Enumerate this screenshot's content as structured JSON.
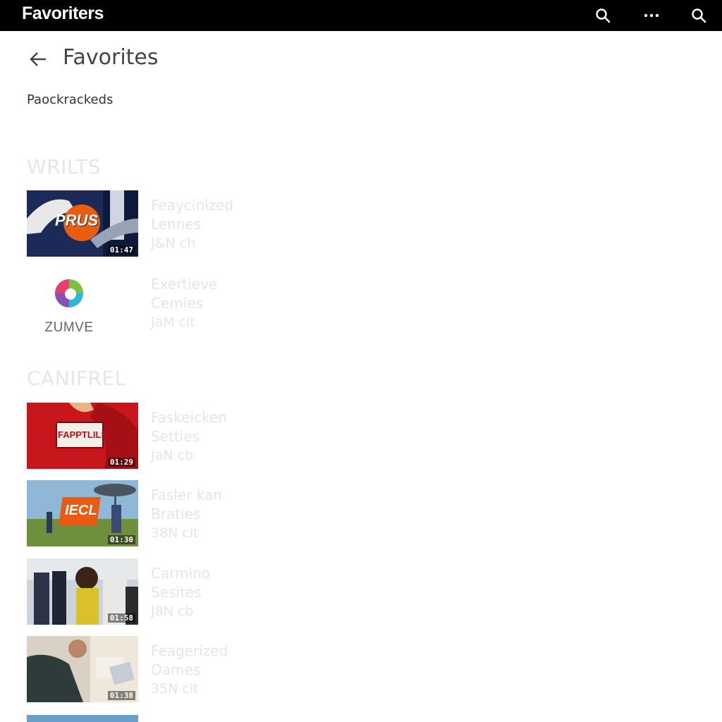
{
  "topbar": {
    "app_title": "Favoriters",
    "icons": [
      "search-icon",
      "more-icon",
      "search-icon"
    ]
  },
  "header": {
    "title": "Favorites",
    "subheader": "Paockrackeds"
  },
  "sections": [
    {
      "title": "WRILTS",
      "items": [
        {
          "thumb": "prus",
          "thumb_text": "PRUS",
          "duration": "01:47",
          "line1": "Feaycinized",
          "line2": "Lennes",
          "line3": "J&N ch"
        },
        {
          "thumb": "zumve-logo",
          "logo_text": "ZUMVE",
          "line1": "Exertieve",
          "line2": "Cemies",
          "line3": "JaM cit"
        }
      ]
    },
    {
      "title": "CANIFREL",
      "items": [
        {
          "thumb": "red",
          "thumb_text": "FAPPTLILS",
          "duration": "01:29",
          "line1": "Faskeicken",
          "line2": "Setties",
          "line3": "JaN cb"
        },
        {
          "thumb": "field",
          "thumb_text": "IECL",
          "duration": "01:30",
          "line1": "Fasler kan",
          "line2": "Braties",
          "line3": "38N cit"
        },
        {
          "thumb": "people",
          "duration": "01:58",
          "line1": "Carmino",
          "line2": "Sesites",
          "line3": "J8N cb"
        },
        {
          "thumb": "laptop",
          "duration": "01:38",
          "line1": "Feagerized",
          "line2": "Oames",
          "line3": "35N cit"
        }
      ]
    }
  ]
}
